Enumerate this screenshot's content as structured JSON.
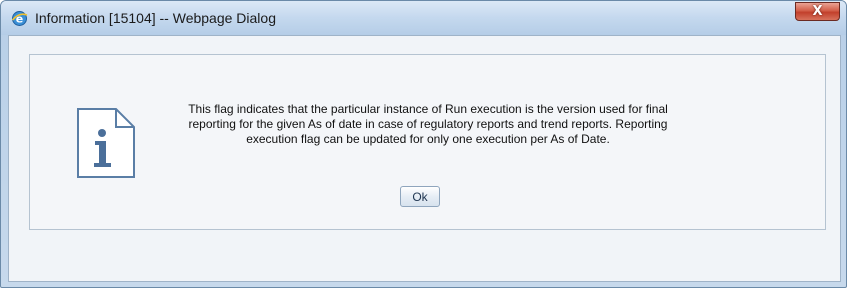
{
  "window": {
    "title": "Information [15104] -- Webpage Dialog",
    "close_label": "X"
  },
  "dialog": {
    "message": "This flag indicates that the particular instance of Run execution is the version used for final reporting for the given As of date in case of regulatory reports and trend reports. Reporting execution flag can be updated for only one execution per As of Date.",
    "ok_label": "Ok",
    "icon": "info-document-icon"
  },
  "colors": {
    "titlebar": "#c4d8ee",
    "close_button": "#c2402c",
    "panel_background": "#f4f6f9",
    "icon_stroke": "#5a7ea6"
  }
}
